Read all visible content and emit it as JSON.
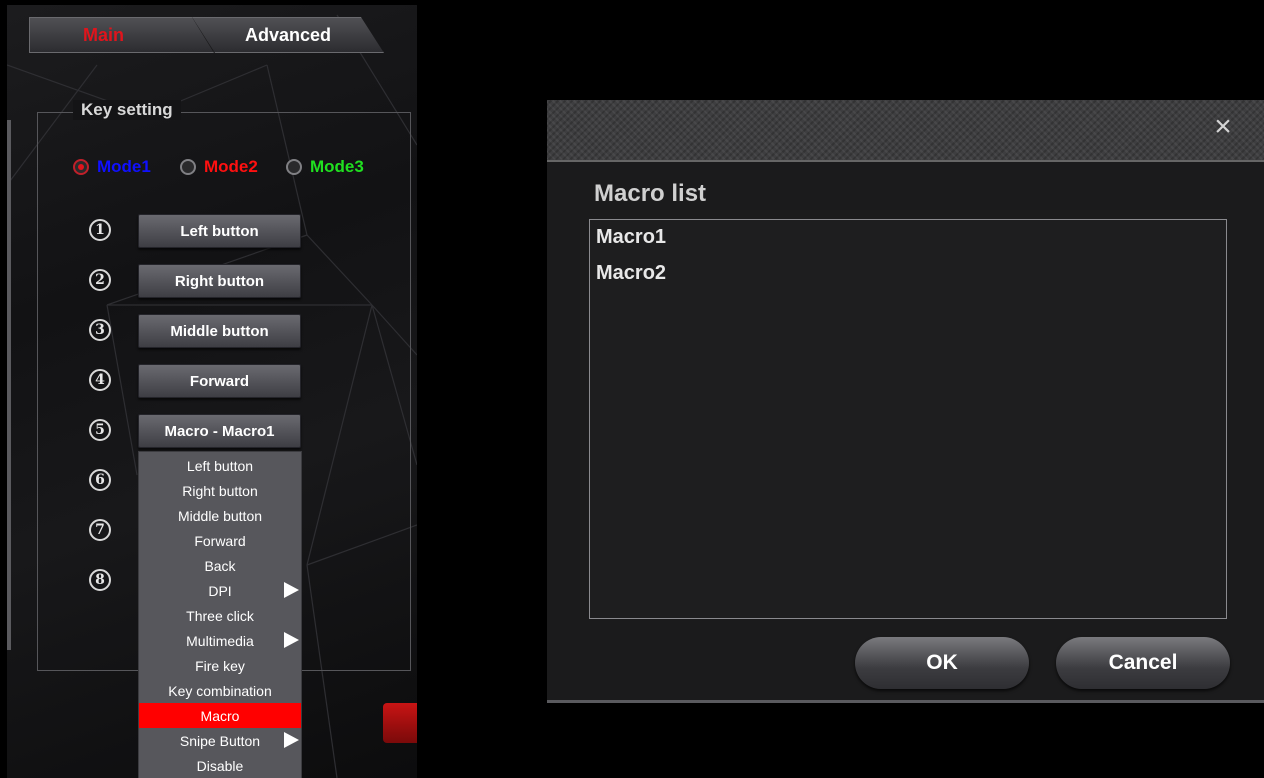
{
  "tabs": {
    "main": "Main",
    "advanced": "Advanced"
  },
  "key_setting": {
    "title": "Key setting",
    "modes": [
      {
        "label": "Mode1",
        "color": "#1010ff",
        "checked": true
      },
      {
        "label": "Mode2",
        "color": "#ff1010",
        "checked": false
      },
      {
        "label": "Mode3",
        "color": "#20e020",
        "checked": false
      }
    ],
    "rows": [
      {
        "num": "1",
        "label": "Left button"
      },
      {
        "num": "2",
        "label": "Right button"
      },
      {
        "num": "3",
        "label": "Middle button"
      },
      {
        "num": "4",
        "label": "Forward"
      },
      {
        "num": "5",
        "label": "Macro - Macro1"
      },
      {
        "num": "6",
        "label": ""
      },
      {
        "num": "7",
        "label": ""
      },
      {
        "num": "8",
        "label": ""
      }
    ]
  },
  "dropdown": {
    "items": [
      {
        "label": "Left button"
      },
      {
        "label": "Right button"
      },
      {
        "label": "Middle button"
      },
      {
        "label": "Forward"
      },
      {
        "label": "Back"
      },
      {
        "label": "DPI",
        "submenu": true
      },
      {
        "label": "Three click"
      },
      {
        "label": "Multimedia",
        "submenu": true
      },
      {
        "label": "Fire key"
      },
      {
        "label": "Key combination"
      },
      {
        "label": "Macro",
        "selected": true
      },
      {
        "label": "Snipe Button",
        "submenu": true
      },
      {
        "label": "Disable"
      }
    ]
  },
  "dialog": {
    "close_icon": "×",
    "title": "Macro list",
    "items": [
      "Macro1",
      "Macro2"
    ],
    "ok_label": "OK",
    "cancel_label": "Cancel"
  }
}
